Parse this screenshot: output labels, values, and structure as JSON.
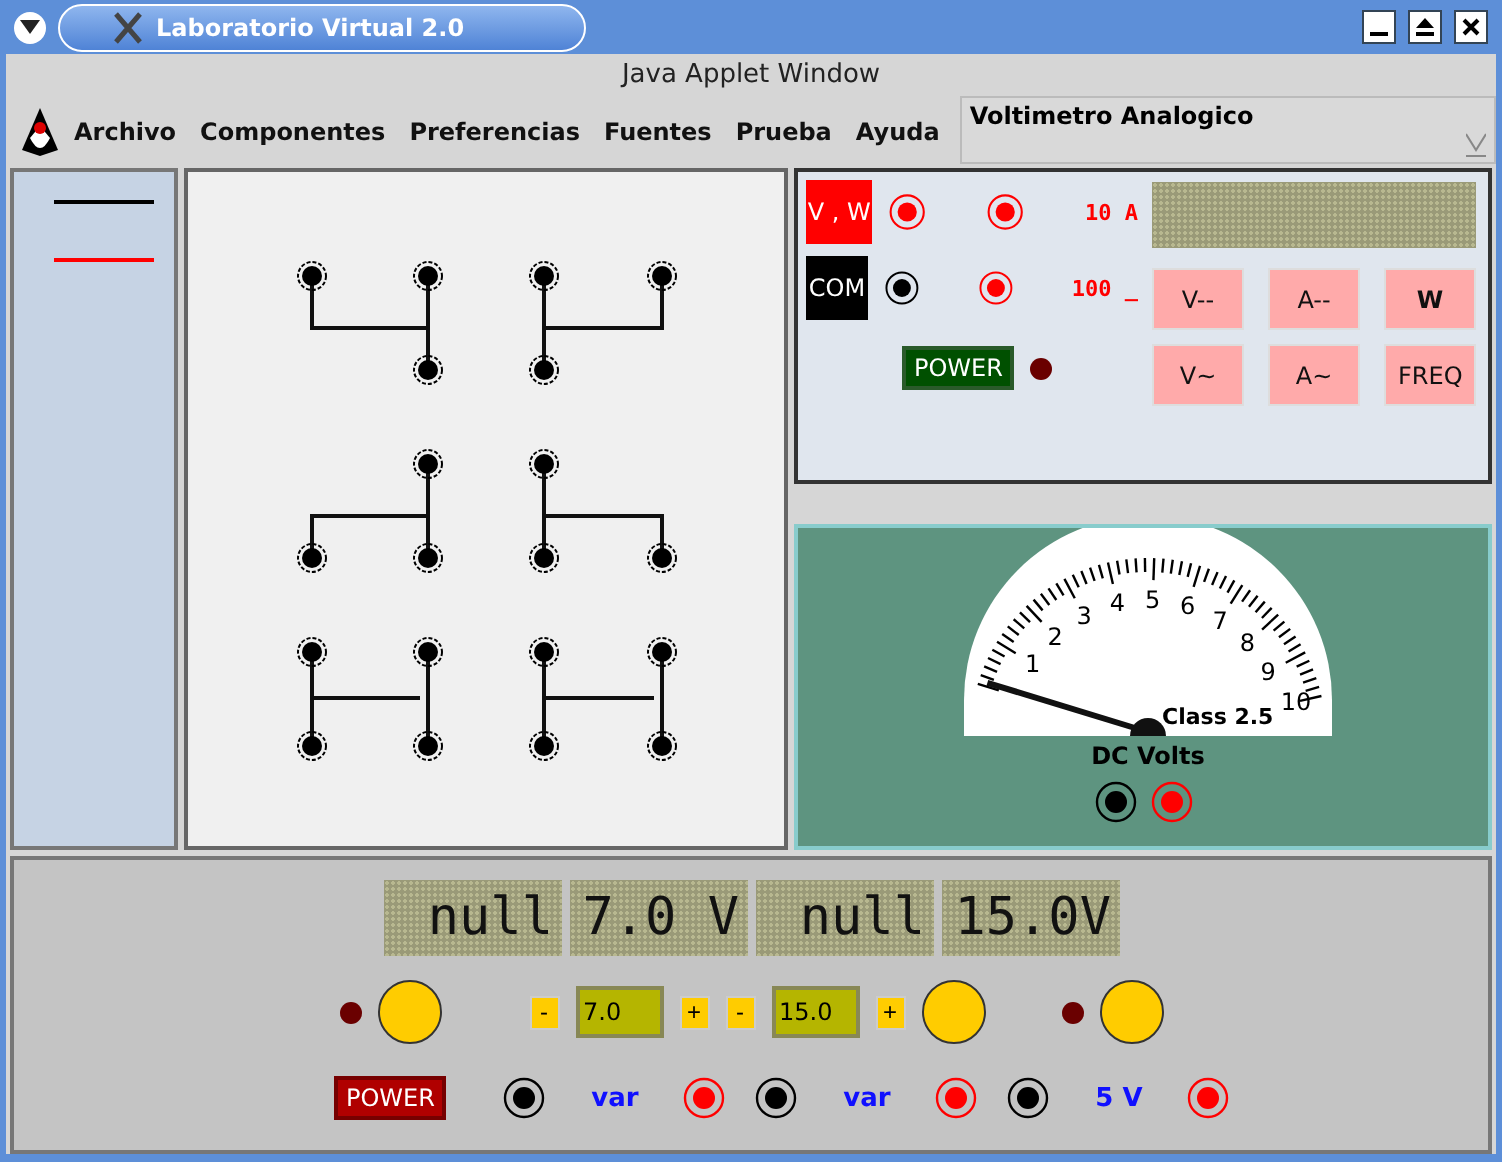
{
  "window": {
    "title": "Laboratorio Virtual 2.0"
  },
  "applet_banner": "Java Applet Window",
  "menu": {
    "items": [
      "Archivo",
      "Componentes",
      "Preferencias",
      "Fuentes",
      "Prueba",
      "Ayuda"
    ],
    "instrument_select": {
      "value": "Voltimetro Analogico"
    }
  },
  "wire_palette": [
    {
      "color": "#000000"
    },
    {
      "color": "#ff0000"
    }
  ],
  "multimeter": {
    "terminals": [
      {
        "label": "V , W",
        "kind": "red"
      },
      {
        "label": "COM",
        "kind": "black"
      }
    ],
    "ranges": [
      "10 A",
      "100 _"
    ],
    "power": {
      "label": "POWER",
      "on": false
    },
    "modes": [
      "V--",
      "A--",
      "W",
      "V~",
      "A~",
      "FREQ"
    ]
  },
  "analog_meter": {
    "scale_labels": [
      "1",
      "2",
      "3",
      "4",
      "5",
      "6",
      "7",
      "8",
      "9",
      "10"
    ],
    "class_label": "Class 2.5",
    "unit_label": "DC Volts"
  },
  "power_supply": {
    "displays": [
      "null",
      "7.0 V",
      "null",
      "15.0V"
    ],
    "setpoints": [
      {
        "value": "7.0",
        "minus": "-",
        "plus": "+"
      },
      {
        "value": "15.0",
        "minus": "-",
        "plus": "+"
      }
    ],
    "power": {
      "label": "POWER",
      "on": false
    },
    "outputs": [
      "var",
      "var",
      "5 V"
    ]
  }
}
